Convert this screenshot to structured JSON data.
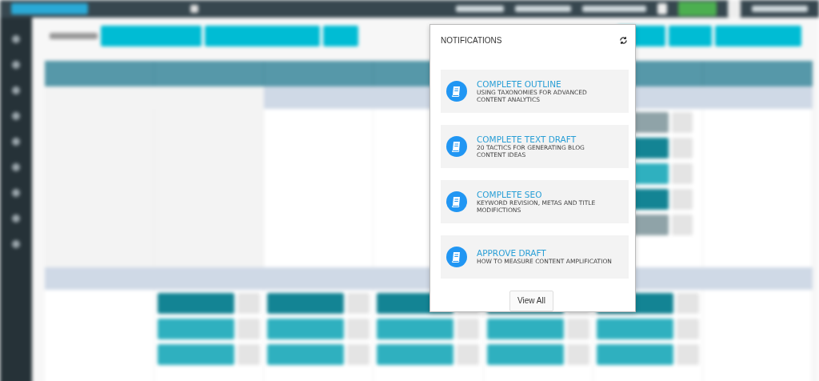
{
  "notifications": {
    "title": "NOTIFICATIONS",
    "items": [
      {
        "title": "COMPLETE OUTLINE",
        "subtitle": "USING TAXONOMIES FOR ADVANCED CONTENT ANALYTICS"
      },
      {
        "title": "COMPLETE TEXT DRAFT",
        "subtitle": "20 TACTICS FOR GENERATING BLOG CONTENT IDEAS"
      },
      {
        "title": "COMPLETE SEO",
        "subtitle": "KEYWORD REVISION, METAS AND TITLE MODIFICTIONS"
      },
      {
        "title": "APPROVE DRAFT",
        "subtitle": "HOW TO MEASURE CONTENT AMPLIFICATION"
      }
    ],
    "view_all": "View All"
  }
}
